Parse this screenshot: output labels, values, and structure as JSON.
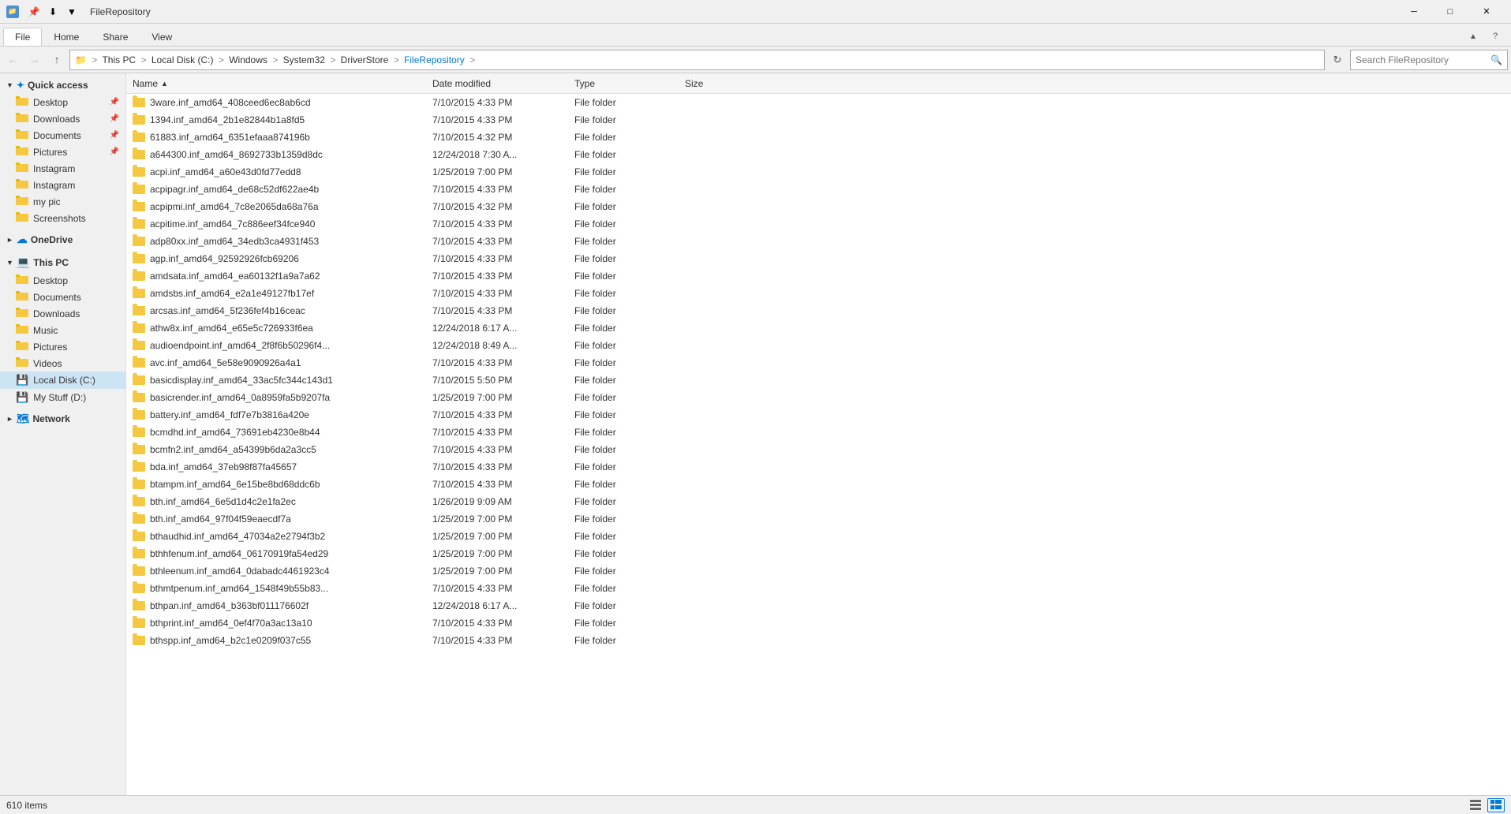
{
  "titleBar": {
    "title": "FileRepository",
    "windowIcon": "📁",
    "quickAccess": [
      "📌",
      "⬇",
      "📋"
    ],
    "controls": [
      "─",
      "□",
      "✕"
    ]
  },
  "ribbon": {
    "tabs": [
      "File",
      "Home",
      "Share",
      "View"
    ],
    "activeTab": "File"
  },
  "addressBar": {
    "breadcrumbs": [
      "This PC",
      "Local Disk (C:)",
      "Windows",
      "System32",
      "DriverStore",
      "FileRepository"
    ],
    "searchPlaceholder": "Search FileRepository"
  },
  "sidebar": {
    "quickAccess": {
      "label": "Quick access",
      "items": [
        {
          "name": "Desktop",
          "pinned": true
        },
        {
          "name": "Downloads",
          "pinned": true
        },
        {
          "name": "Documents",
          "pinned": true
        },
        {
          "name": "Pictures",
          "pinned": true
        },
        {
          "name": "Instagram",
          "pinned": false
        },
        {
          "name": "Instagram",
          "pinned": false
        },
        {
          "name": "my pic",
          "pinned": false
        },
        {
          "name": "Screenshots",
          "pinned": false
        }
      ]
    },
    "oneDrive": {
      "label": "OneDrive"
    },
    "thisPC": {
      "label": "This PC",
      "items": [
        {
          "name": "Desktop"
        },
        {
          "name": "Documents"
        },
        {
          "name": "Downloads"
        },
        {
          "name": "Music"
        },
        {
          "name": "Pictures"
        },
        {
          "name": "Videos"
        },
        {
          "name": "Local Disk (C:)",
          "active": true
        },
        {
          "name": "My Stuff (D:)"
        }
      ]
    },
    "network": {
      "label": "Network"
    }
  },
  "fileList": {
    "columns": [
      "Name",
      "Date modified",
      "Type",
      "Size"
    ],
    "rows": [
      {
        "name": "3ware.inf_amd64_408ceed6ec8ab6cd",
        "modified": "7/10/2015 4:33 PM",
        "type": "File folder",
        "size": ""
      },
      {
        "name": "1394.inf_amd64_2b1e82844b1a8fd5",
        "modified": "7/10/2015 4:33 PM",
        "type": "File folder",
        "size": ""
      },
      {
        "name": "61883.inf_amd64_6351efaaa874196b",
        "modified": "7/10/2015 4:32 PM",
        "type": "File folder",
        "size": ""
      },
      {
        "name": "a644300.inf_amd64_8692733b1359d8dc",
        "modified": "12/24/2018 7:30 A...",
        "type": "File folder",
        "size": ""
      },
      {
        "name": "acpi.inf_amd64_a60e43d0fd77edd8",
        "modified": "1/25/2019 7:00 PM",
        "type": "File folder",
        "size": ""
      },
      {
        "name": "acpipagr.inf_amd64_de68c52df622ae4b",
        "modified": "7/10/2015 4:33 PM",
        "type": "File folder",
        "size": ""
      },
      {
        "name": "acpipmi.inf_amd64_7c8e2065da68a76a",
        "modified": "7/10/2015 4:32 PM",
        "type": "File folder",
        "size": ""
      },
      {
        "name": "acpitime.inf_amd64_7c886eef34fce940",
        "modified": "7/10/2015 4:33 PM",
        "type": "File folder",
        "size": ""
      },
      {
        "name": "adp80xx.inf_amd64_34edb3ca4931f453",
        "modified": "7/10/2015 4:33 PM",
        "type": "File folder",
        "size": ""
      },
      {
        "name": "agp.inf_amd64_92592926fcb69206",
        "modified": "7/10/2015 4:33 PM",
        "type": "File folder",
        "size": ""
      },
      {
        "name": "amdsata.inf_amd64_ea60132f1a9a7a62",
        "modified": "7/10/2015 4:33 PM",
        "type": "File folder",
        "size": ""
      },
      {
        "name": "amdsbs.inf_amd64_e2a1e49127fb17ef",
        "modified": "7/10/2015 4:33 PM",
        "type": "File folder",
        "size": ""
      },
      {
        "name": "arcsas.inf_amd64_5f236fef4b16ceac",
        "modified": "7/10/2015 4:33 PM",
        "type": "File folder",
        "size": ""
      },
      {
        "name": "athw8x.inf_amd64_e65e5c726933f6ea",
        "modified": "12/24/2018 6:17 A...",
        "type": "File folder",
        "size": ""
      },
      {
        "name": "audioendpoint.inf_amd64_2f8f6b50296f4...",
        "modified": "12/24/2018 8:49 A...",
        "type": "File folder",
        "size": ""
      },
      {
        "name": "avc.inf_amd64_5e58e9090926a4a1",
        "modified": "7/10/2015 4:33 PM",
        "type": "File folder",
        "size": ""
      },
      {
        "name": "basicdisplay.inf_amd64_33ac5fc344c143d1",
        "modified": "7/10/2015 5:50 PM",
        "type": "File folder",
        "size": ""
      },
      {
        "name": "basicrender.inf_amd64_0a8959fa5b9207fa",
        "modified": "1/25/2019 7:00 PM",
        "type": "File folder",
        "size": ""
      },
      {
        "name": "battery.inf_amd64_fdf7e7b3816a420e",
        "modified": "7/10/2015 4:33 PM",
        "type": "File folder",
        "size": ""
      },
      {
        "name": "bcmdhd.inf_amd64_73691eb4230e8b44",
        "modified": "7/10/2015 4:33 PM",
        "type": "File folder",
        "size": ""
      },
      {
        "name": "bcmfn2.inf_amd64_a54399b6da2a3cc5",
        "modified": "7/10/2015 4:33 PM",
        "type": "File folder",
        "size": ""
      },
      {
        "name": "bda.inf_amd64_37eb98f87fa45657",
        "modified": "7/10/2015 4:33 PM",
        "type": "File folder",
        "size": ""
      },
      {
        "name": "btampm.inf_amd64_6e15be8bd68ddc6b",
        "modified": "7/10/2015 4:33 PM",
        "type": "File folder",
        "size": ""
      },
      {
        "name": "bth.inf_amd64_6e5d1d4c2e1fa2ec",
        "modified": "1/26/2019 9:09 AM",
        "type": "File folder",
        "size": ""
      },
      {
        "name": "bth.inf_amd64_97f04f59eaecdf7a",
        "modified": "1/25/2019 7:00 PM",
        "type": "File folder",
        "size": ""
      },
      {
        "name": "bthaudhid.inf_amd64_47034a2e2794f3b2",
        "modified": "1/25/2019 7:00 PM",
        "type": "File folder",
        "size": ""
      },
      {
        "name": "bthhfenum.inf_amd64_06170919fa54ed29",
        "modified": "1/25/2019 7:00 PM",
        "type": "File folder",
        "size": ""
      },
      {
        "name": "bthleenum.inf_amd64_0dabadc4461923c4",
        "modified": "1/25/2019 7:00 PM",
        "type": "File folder",
        "size": ""
      },
      {
        "name": "bthmtpenum.inf_amd64_1548f49b55b83...",
        "modified": "7/10/2015 4:33 PM",
        "type": "File folder",
        "size": ""
      },
      {
        "name": "bthpan.inf_amd64_b363bf011176602f",
        "modified": "12/24/2018 6:17 A...",
        "type": "File folder",
        "size": ""
      },
      {
        "name": "bthprint.inf_amd64_0ef4f70a3ac13a10",
        "modified": "7/10/2015 4:33 PM",
        "type": "File folder",
        "size": ""
      },
      {
        "name": "bthspp.inf_amd64_b2c1e0209f037c55",
        "modified": "7/10/2015 4:33 PM",
        "type": "File folder",
        "size": ""
      }
    ]
  },
  "statusBar": {
    "itemCount": "610 items",
    "views": [
      "list",
      "details"
    ]
  }
}
